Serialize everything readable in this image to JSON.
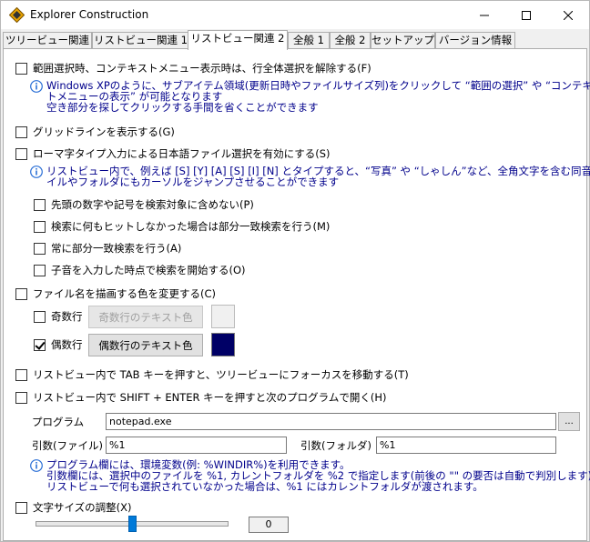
{
  "window": {
    "title": "Explorer Construction"
  },
  "tabs": [
    {
      "label": "ツリービュー関連"
    },
    {
      "label": "リストビュー関連 1"
    },
    {
      "label": "リストビュー関連 2"
    },
    {
      "label": "全般 1"
    },
    {
      "label": "全般 2"
    },
    {
      "label": "セットアップ"
    },
    {
      "label": "バージョン情報"
    }
  ],
  "opts": {
    "range_select": {
      "label": "範囲選択時、コンテキストメニュー表示時は、行全体選択を解除する(F)",
      "checked": false
    },
    "range_info": [
      "Windows XPのように、サブアイテム領域(更新日時やファイルサイズ列)をクリックして “範囲の選択” や “コンテキス",
      "トメニューの表示” が可能となります",
      "空き部分を探してクリックする手間を省くことができます"
    ],
    "grid": {
      "label": "グリッドラインを表示する(G)",
      "checked": false
    },
    "romaji": {
      "label": "ローマ字タイプ入力による日本語ファイル選択を有効にする(S)",
      "checked": false
    },
    "romaji_info": [
      "リストビュー内で、例えば [S] [Y] [A] [S] [I] [N] とタイプすると、“写真” や “しゃしん”など、全角文字を含む同音ファ",
      "イルやフォルダにもカーソルをジャンプさせることができます"
    ],
    "romaji_sub": [
      {
        "label": "先頭の数字や記号を検索対象に含めない(P)",
        "checked": false
      },
      {
        "label": "検索に何もヒットしなかった場合は部分一致検索を行う(M)",
        "checked": false
      },
      {
        "label": "常に部分一致検索を行う(A)",
        "checked": false
      },
      {
        "label": "子音を入力した時点で検索を開始する(O)",
        "checked": false
      }
    ],
    "filename_color": {
      "label": "ファイル名を描画する色を変更する(C)",
      "checked": false
    },
    "odd": {
      "label": "奇数行",
      "checked": false,
      "button": "奇数行のテキスト色",
      "color": "#f0f0f0"
    },
    "even": {
      "label": "偶数行",
      "checked": true,
      "button": "偶数行のテキスト色",
      "color": "#000066"
    },
    "tab_key": {
      "label": "リストビュー内で TAB キーを押すと、ツリービューにフォーカスを移動する(T)",
      "checked": false
    },
    "shift_enter": {
      "label": "リストビュー内で SHIFT + ENTER キーを押すと次のプログラムで開く(H)",
      "checked": false
    },
    "program": {
      "label": "プログラム",
      "value": "notepad.exe",
      "browse": "..."
    },
    "arg_file": {
      "label": "引数(ファイル)",
      "value": "%1"
    },
    "arg_folder": {
      "label": "引数(フォルダ)",
      "value": "%1"
    },
    "program_info": [
      "プログラム欄には、環境変数(例: %WINDIR%)を利用できます。",
      "引数欄には、選択中のファイルを %1, カレントフォルダを %2 で指定します(前後の \"\" の要否は自動で判別します)",
      "リストビューで何も選択されていなかった場合は、%1 にはカレントフォルダが渡されます。"
    ],
    "font_size": {
      "label": "文字サイズの調整(X)",
      "checked": false,
      "value": "0",
      "slider_fraction": 0.5
    }
  }
}
